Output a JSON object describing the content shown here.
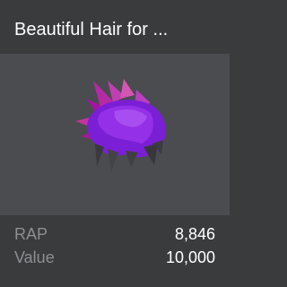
{
  "item": {
    "title": "Beautiful Hair for ...",
    "thumbnail_icon": "purple-spiky-hair-accessory",
    "colors": {
      "hair_primary": "#8a2be2",
      "hair_highlight": "#b03ad0",
      "hair_tips": "#d04aa0"
    }
  },
  "stats": {
    "rap_label": "RAP",
    "rap_value": "8,846",
    "value_label": "Value",
    "value_value": "10,000"
  }
}
